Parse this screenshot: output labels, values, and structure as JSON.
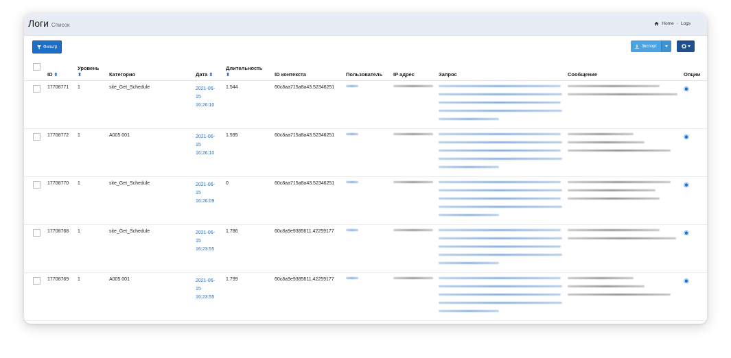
{
  "header": {
    "title": "Логи",
    "subtitle": "Список"
  },
  "breadcrumb": {
    "home": "Home",
    "current": "Logs"
  },
  "toolbar": {
    "filter_label": "Фильтр",
    "export_label": "Экспорт"
  },
  "table": {
    "columns": {
      "id": "ID",
      "level": "Уровень",
      "category": "Категория",
      "date": "Дата",
      "duration": "Длительность",
      "context_id": "ID контекста",
      "user": "Пользователь",
      "ip": "IP адрес",
      "request": "Запрос",
      "message": "Сообщение",
      "options": "Опции"
    },
    "rows": [
      {
        "id": "17708771",
        "level": "1",
        "category": "site_Get_Schedule",
        "date_1": "2021-06-",
        "date_2": "15",
        "date_3": "16:26:10",
        "duration": "1.544",
        "context_id": "60c8aa715a8a43.52346251"
      },
      {
        "id": "17708772",
        "level": "1",
        "category": "A005 001",
        "date_1": "2021-06-",
        "date_2": "15",
        "date_3": "16:26:10",
        "duration": "1.595",
        "context_id": "60c8aa715a8a43.52346251"
      },
      {
        "id": "17708770",
        "level": "1",
        "category": "site_Get_Schedule",
        "date_1": "2021-06-",
        "date_2": "15",
        "date_3": "16:26:09",
        "duration": "0",
        "context_id": "60c8aa715a8a43.52346251"
      },
      {
        "id": "17708768",
        "level": "1",
        "category": "site_Get_Schedule",
        "date_1": "2021-06-",
        "date_2": "15",
        "date_3": "16:23:55",
        "duration": "1.786",
        "context_id": "60c8a9e9385611.42259177"
      },
      {
        "id": "17708769",
        "level": "1",
        "category": "A005 001",
        "date_1": "2021-06-",
        "date_2": "15",
        "date_3": "16:23:55",
        "duration": "1.799",
        "context_id": "60c8a9e9385611.42259177"
      }
    ]
  },
  "colors": {
    "primary": "#1e6fc7",
    "export": "#4ba3e3",
    "settings": "#1f4f8f",
    "header_bg": "#e8ecf4"
  },
  "icons": {
    "filter": "filter-icon",
    "export": "download-icon",
    "settings": "gear-icon",
    "home": "home-icon",
    "view": "eye-icon",
    "sort": "sort-icon"
  }
}
